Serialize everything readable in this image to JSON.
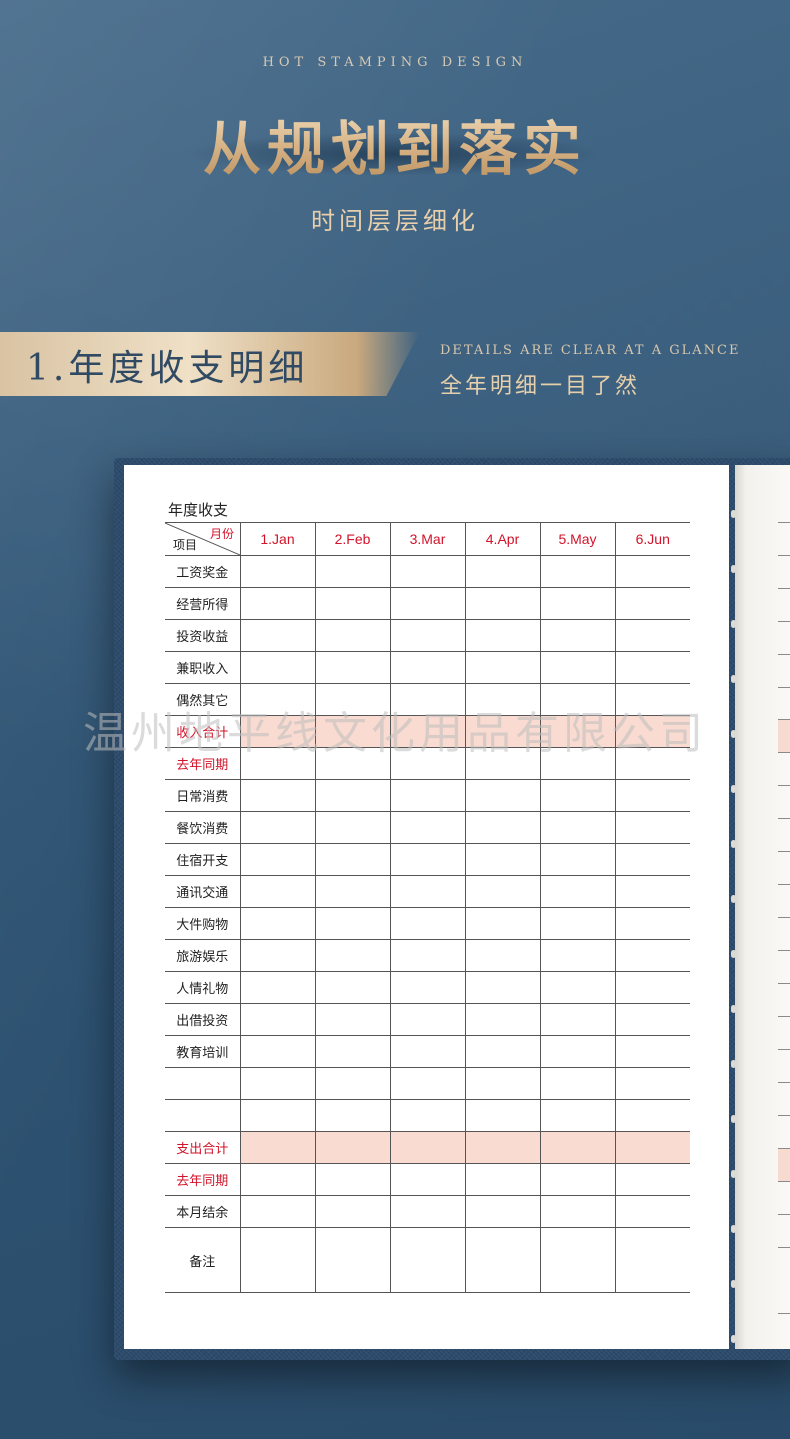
{
  "header": {
    "eyebrow": "HOT STAMPING DESIGN",
    "title": "从规划到落实",
    "subtitle": "时间层层细化"
  },
  "section": {
    "label": "1.年度收支明细",
    "en": "DETAILS ARE CLEAR AT A GLANCE",
    "cn": "全年明细一目了然"
  },
  "sheet": {
    "title": "年度收支",
    "corner_top": "月份",
    "corner_bottom": "项目",
    "months": [
      "1.Jan",
      "2.Feb",
      "3.Mar",
      "4.Apr",
      "5.May",
      "6.Jun"
    ],
    "rows": [
      {
        "label": "工资奖金"
      },
      {
        "label": "经营所得"
      },
      {
        "label": "投资收益"
      },
      {
        "label": "兼职收入"
      },
      {
        "label": "偶然其它"
      },
      {
        "label": "收入合计"
      },
      {
        "label": "去年同期"
      },
      {
        "label": "日常消费"
      },
      {
        "label": "餐饮消费"
      },
      {
        "label": "住宿开支"
      },
      {
        "label": "通讯交通"
      },
      {
        "label": "大件购物"
      },
      {
        "label": "旅游娱乐"
      },
      {
        "label": "人情礼物"
      },
      {
        "label": "出借投资"
      },
      {
        "label": "教育培训"
      },
      {
        "label": ""
      },
      {
        "label": ""
      },
      {
        "label": "支出合计"
      },
      {
        "label": "去年同期"
      },
      {
        "label": "本月结余"
      },
      {
        "label": "备注"
      }
    ]
  },
  "watermark": "温州地平线文化用品有限公司",
  "colors": {
    "background": "#2f5474",
    "gold": "#e3c79c",
    "accent_red": "#d2132a",
    "highlight_pink": "#f9dbd1"
  }
}
